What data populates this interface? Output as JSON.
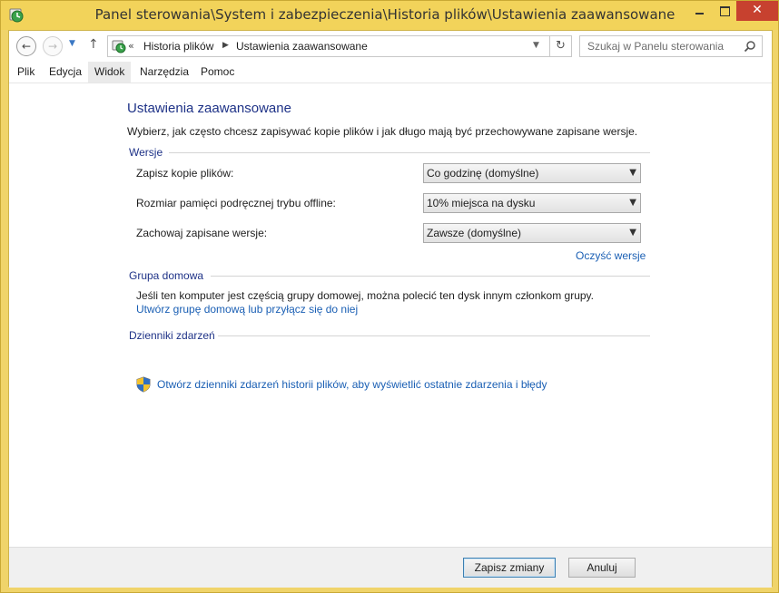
{
  "window": {
    "title": "Panel sterowania\\System i zabezpieczenia\\Historia plików\\Ustawienia zaawansowane",
    "close_glyph": "✕"
  },
  "nav": {
    "back_glyph": "←",
    "forward_glyph": "→",
    "history_glyph": "▼",
    "up_glyph": "↑",
    "chevron_glyph": "«",
    "breadcrumb": [
      "Historia plików",
      "Ustawienia zaawansowane"
    ],
    "separator_glyph": "▶",
    "address_dropdown_glyph": "▼",
    "refresh_glyph": "↻",
    "search_placeholder": "Szukaj w Panelu sterowania"
  },
  "menu": {
    "items": [
      "Plik",
      "Edycja",
      "Widok",
      "Narzędzia",
      "Pomoc"
    ],
    "active": "Widok"
  },
  "page": {
    "title": "Ustawienia zaawansowane",
    "description": "Wybierz, jak często chcesz zapisywać kopie plików i jak długo mają być przechowywane zapisane wersje."
  },
  "versions": {
    "header": "Wersje",
    "options": [
      {
        "label": "Zapisz kopie plików:",
        "value": "Co godzinę (domyślne)"
      },
      {
        "label": "Rozmiar pamięci podręcznej trybu offline:",
        "value": "10% miejsca na dysku"
      },
      {
        "label": "Zachowaj zapisane wersje:",
        "value": "Zawsze (domyślne)"
      }
    ],
    "dropdown_glyph": "▼",
    "clean_link": "Oczyść wersje"
  },
  "homegroup": {
    "header": "Grupa domowa",
    "text": "Jeśli ten komputer jest częścią grupy domowej, można polecić ten dysk innym członkom grupy.",
    "link": "Utwórz grupę domową lub przyłącz się do niej"
  },
  "eventlogs": {
    "header": "Dzienniki zdarzeń",
    "link": "Otwórz dzienniki zdarzeń historii plików, aby wyświetlić ostatnie zdarzenia i błędy"
  },
  "footer": {
    "save_label": "Zapisz zmiany",
    "cancel_label": "Anuluj"
  },
  "colors": {
    "frame": "#f2d35a",
    "close_button": "#c7412f",
    "heading": "#1e3287",
    "link": "#1a5fb4"
  }
}
